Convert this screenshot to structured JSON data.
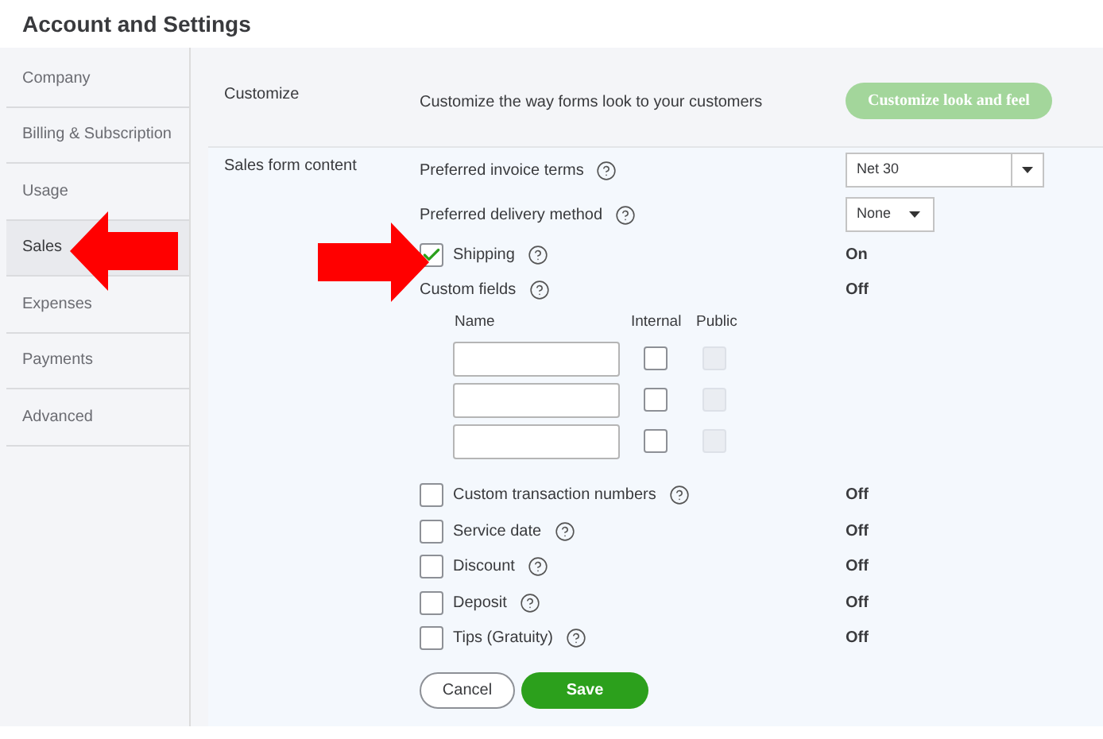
{
  "title": "Account and Settings",
  "sidebar": {
    "items": [
      {
        "label": "Company",
        "selected": false
      },
      {
        "label": "Billing & Subscription",
        "selected": false
      },
      {
        "label": "Usage",
        "selected": false
      },
      {
        "label": "Sales",
        "selected": true
      },
      {
        "label": "Expenses",
        "selected": false
      },
      {
        "label": "Payments",
        "selected": false
      },
      {
        "label": "Advanced",
        "selected": false
      }
    ]
  },
  "customize": {
    "label": "Customize",
    "description": "Customize the way forms look to your customers",
    "button": "Customize look and feel"
  },
  "sales_form": {
    "label": "Sales form content",
    "settings": [
      {
        "kind": "combobox",
        "label": "Preferred invoice terms",
        "value": "Net 30"
      },
      {
        "kind": "select",
        "label": "Preferred delivery method",
        "value": "None"
      },
      {
        "kind": "checkbox",
        "label": "Shipping",
        "checked": true,
        "status": "On"
      },
      {
        "kind": "custom_fields",
        "label": "Custom fields",
        "status": "Off",
        "columns": [
          "Name",
          "Internal",
          "Public"
        ],
        "rows": [
          {
            "internal": false,
            "public_disabled": true
          },
          {
            "internal": false,
            "public_disabled": true
          },
          {
            "internal": false,
            "public_disabled": true
          }
        ]
      },
      {
        "kind": "checkbox",
        "label": "Custom transaction numbers",
        "checked": false,
        "status": "Off"
      },
      {
        "kind": "checkbox",
        "label": "Service date",
        "checked": false,
        "status": "Off"
      },
      {
        "kind": "checkbox",
        "label": "Discount",
        "checked": false,
        "status": "Off"
      },
      {
        "kind": "checkbox",
        "label": "Deposit",
        "checked": false,
        "status": "Off"
      },
      {
        "kind": "checkbox",
        "label": "Tips (Gratuity)",
        "checked": false,
        "status": "Off"
      }
    ],
    "buttons": {
      "cancel": "Cancel",
      "save": "Save"
    }
  }
}
